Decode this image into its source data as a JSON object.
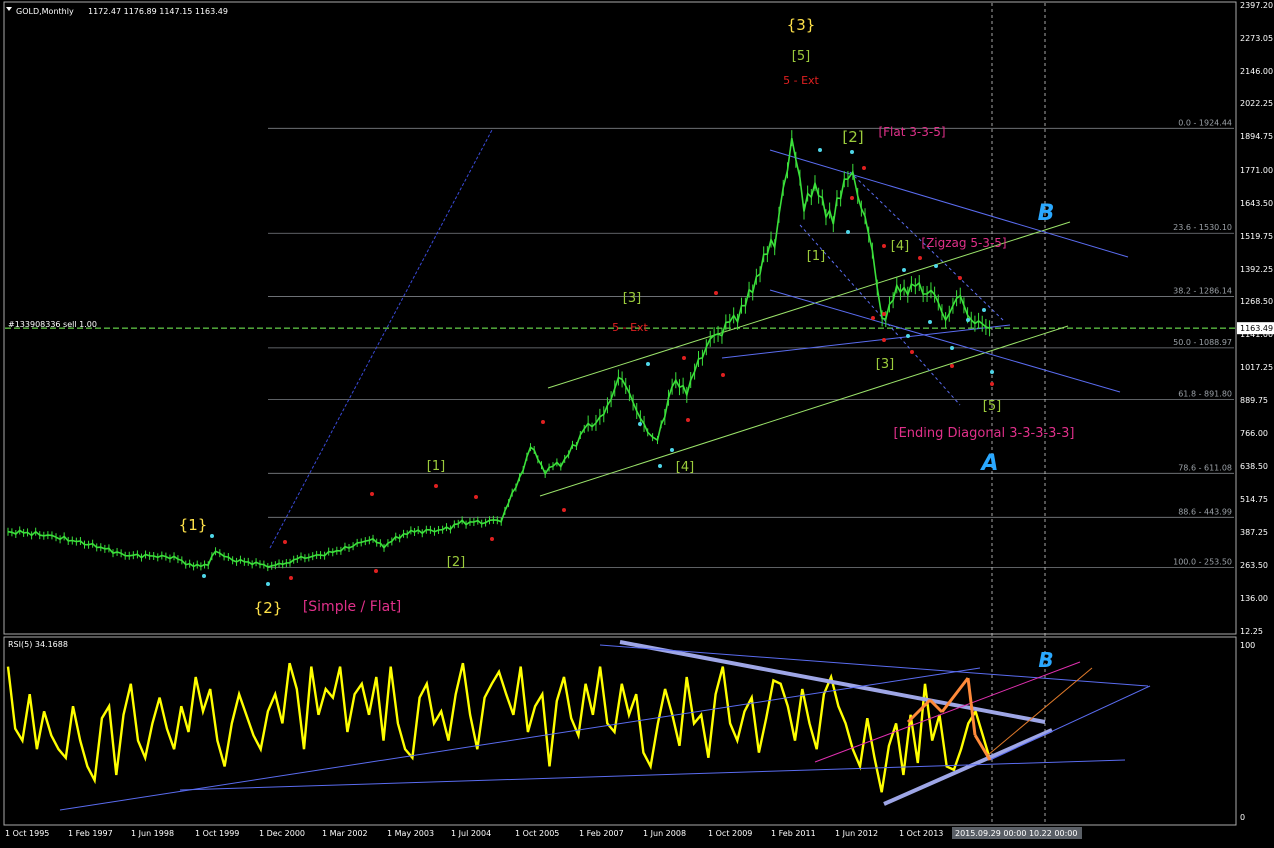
{
  "window": {
    "symbol_label": "GOLD,Monthly",
    "ohlc": "1172.47 1176.89 1147.15 1163.49"
  },
  "order_line_label": "#133908336 sell 1.00",
  "current_price_label": "1163.49",
  "colors": {
    "background": "#000000",
    "candle": "#3be03b",
    "grid": "#9aa0a6",
    "rsi_line": "#ffff00",
    "wave_yellow": "#ffe24a",
    "wave_green": "#9ccc3c",
    "wave_red": "#e02020",
    "wave_orange": "#e07a2a",
    "wave_cyan": "#4fd6e8",
    "wave_magenta": "#e0308a",
    "channel_blue": "#5a6cf0",
    "channel_green": "#9be36a",
    "annotation_arrows": "#ff8a3a",
    "current_price_line": "#7cff5a"
  },
  "chart_data": [
    {
      "type": "line",
      "title": "GOLD,Monthly",
      "y_ticks": [
        "2397.20",
        "2273.05",
        "2146.00",
        "2022.25",
        "1894.75",
        "1771.00",
        "1643.50",
        "1519.75",
        "1392.25",
        "1268.50",
        "1141.00",
        "1017.25",
        "889.75",
        "766.00",
        "638.50",
        "514.75",
        "387.25",
        "263.50",
        "136.00",
        "12.25"
      ],
      "x_ticks": [
        "1 Oct 1995",
        "1 Feb 1997",
        "1 Jun 1998",
        "1 Oct 1999",
        "1 Dec 2000",
        "1 Mar 2002",
        "1 May 2003",
        "1 Jul 2004",
        "1 Oct 2005",
        "1 Feb 2007",
        "1 Jun 2008",
        "1 Oct 2009",
        "1 Feb 2011",
        "1 Jun 2012",
        "1 Oct 2013"
      ],
      "x_tick_highlight": "2015.09.29 00:00 10.22 00:00",
      "fib_levels": [
        {
          "label": "0.0 - 1924.44",
          "value": 1924.44
        },
        {
          "label": "23.6 - 1530.10",
          "value": 1530.1
        },
        {
          "label": "38.2 - 1286.14",
          "value": 1286.14
        },
        {
          "label": "50.0 - 1088.97",
          "value": 1088.97
        },
        {
          "label": "61.8 - 891.80",
          "value": 891.8
        },
        {
          "label": "78.6 - 611.08",
          "value": 611.08
        },
        {
          "label": "88.6 - 443.99",
          "value": 443.99
        },
        {
          "label": "100.0 - 253.50",
          "value": 253.5
        }
      ],
      "current_price": 1163.49,
      "series": [
        {
          "x": [
            1995.6,
            1996.0,
            1996.5,
            1997.0,
            1997.5,
            1998.0,
            1998.5,
            1999.0,
            1999.4,
            1999.7,
            1999.85,
            2000.2,
            2000.6,
            2001.0,
            2001.3,
            2001.6,
            2002.0,
            2002.5,
            2003.0,
            2003.3,
            2003.7,
            2004.0,
            2004.5,
            2004.9,
            2005.3,
            2005.7,
            2006.0,
            2006.3,
            2006.6,
            2007.0,
            2007.4,
            2007.8,
            2008.1,
            2008.4,
            2008.7,
            2008.9,
            2009.2,
            2009.5,
            2009.9,
            2010.3,
            2010.7,
            2011.0,
            2011.3,
            2011.65,
            2011.9,
            2012.2,
            2012.5,
            2012.8,
            2013.0,
            2013.3,
            2013.5,
            2013.8,
            2014.1,
            2014.5,
            2014.8,
            2015.1,
            2015.4,
            2015.7
          ],
          "values": [
            388,
            384,
            372,
            352,
            330,
            300,
            298,
            292,
            258,
            268,
            315,
            282,
            272,
            258,
            272,
            290,
            300,
            325,
            360,
            335,
            380,
            390,
            395,
            425,
            425,
            435,
            560,
            710,
            620,
            660,
            780,
            830,
            980,
            890,
            760,
            740,
            950,
            930,
            1100,
            1170,
            1250,
            1400,
            1500,
            1880,
            1650,
            1690,
            1570,
            1780,
            1680,
            1460,
            1200,
            1300,
            1330,
            1300,
            1210,
            1280,
            1180,
            1163
          ]
        }
      ],
      "wave_labels": [
        "{1}",
        "{2}",
        "{3}",
        "[1]",
        "[2]",
        "[3]",
        "[4]",
        "[5]",
        "[Simple / Flat]",
        "[Flat 3-3-5]",
        "[Zigzag 5-3-5]",
        "[Ending Diagonal 3-3-3-3-3]",
        "5 - Ext",
        "A",
        "B"
      ],
      "ylim": [
        12.25,
        2397.2
      ]
    },
    {
      "type": "line",
      "title": "RSI(5) 34.1688",
      "y_ticks": [
        "100",
        "0"
      ],
      "ylim": [
        0,
        100
      ],
      "series": [
        {
          "name": "RSI(5)",
          "values": [
            88,
            52,
            45,
            72,
            40,
            62,
            48,
            40,
            35,
            65,
            45,
            30,
            22,
            58,
            65,
            25,
            60,
            78,
            45,
            35,
            55,
            70,
            52,
            40,
            65,
            50,
            82,
            62,
            75,
            45,
            30,
            55,
            72,
            60,
            48,
            40,
            62,
            72,
            55,
            90,
            75,
            40,
            88,
            60,
            75,
            70,
            88,
            50,
            72,
            78,
            60,
            82,
            45,
            88,
            55,
            40,
            35,
            70,
            78,
            55,
            62,
            45,
            72,
            90,
            60,
            40,
            70,
            78,
            85,
            72,
            60,
            88,
            50,
            65,
            72,
            30,
            68,
            82,
            58,
            48,
            78,
            60,
            88,
            55,
            50,
            78,
            60,
            72,
            38,
            30,
            55,
            75,
            60,
            42,
            82,
            55,
            60,
            35,
            72,
            88,
            55,
            45,
            62,
            70,
            38,
            58,
            80,
            78,
            65,
            45,
            75,
            55,
            40,
            72,
            82,
            65,
            55,
            40,
            30,
            58,
            35,
            15,
            42,
            55,
            25,
            60,
            32,
            78,
            45,
            60,
            30,
            28,
            40,
            55,
            62,
            48,
            34
          ]
        }
      ],
      "labels": [
        "B"
      ]
    }
  ]
}
